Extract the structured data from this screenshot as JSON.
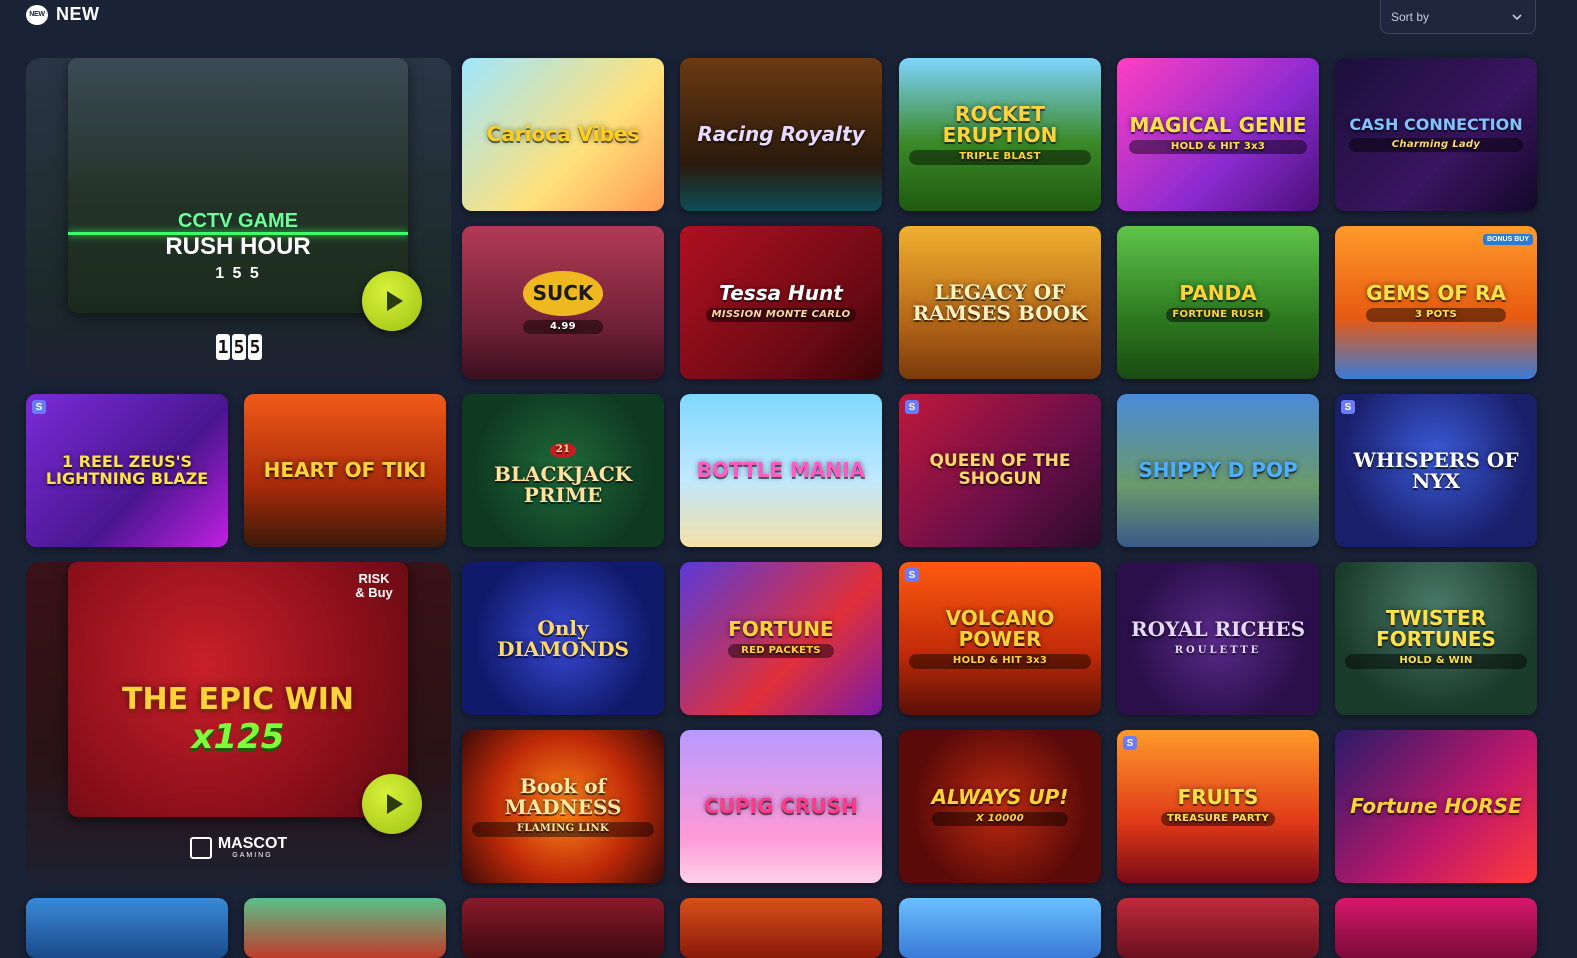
{
  "header": {
    "badge": "NEW",
    "title": "NEW"
  },
  "sort": {
    "label": "Sort by"
  },
  "featured": [
    {
      "line1": "CCTV GAME",
      "line2": "RUSH HOUR",
      "small_count": "1 5 5",
      "counter": [
        "1",
        "5",
        "5"
      ]
    },
    {
      "title": "THE EPIC WIN",
      "multiplier": "x125",
      "corner": "RISK & Buy",
      "provider": "MASCOT",
      "provider_sub": "GAMING"
    }
  ],
  "games": [
    {
      "title": "Carioca Vibes"
    },
    {
      "title": "Racing Royalty"
    },
    {
      "title": "ROCKET ERUPTION",
      "sub": "TRIPLE BLAST"
    },
    {
      "title": "MAGICAL GENIE",
      "sub": "HOLD & HIT 3x3"
    },
    {
      "title": "CASH CONNECTION",
      "sub": "Charming Lady"
    },
    {
      "title": "SUCK",
      "sub": "4.99"
    },
    {
      "title": "Tessa Hunt",
      "sub": "MISSION MONTE CARLO"
    },
    {
      "title": "LEGACY OF RAMSES BOOK"
    },
    {
      "title": "PANDA",
      "sub": "FORTUNE RUSH"
    },
    {
      "title": "GEMS OF RA",
      "sub": "3 POTS",
      "badge": "BONUS BUY"
    },
    {
      "title": "1 REEL ZEUS'S LIGHTNING BLAZE",
      "s": "S"
    },
    {
      "title": "HEART OF TIKI"
    },
    {
      "title": "BLACKJACK PRIME",
      "sub": "21"
    },
    {
      "title": "BOTTLE MANIA"
    },
    {
      "title": "QUEEN OF THE SHOGUN",
      "s": "S"
    },
    {
      "title": "SHIPPY D POP"
    },
    {
      "title": "WHISPERS OF NYX",
      "s": "S"
    },
    {
      "title": "Only DIAMONDS"
    },
    {
      "title": "FORTUNE",
      "sub": "RED PACKETS"
    },
    {
      "title": "VOLCANO POWER",
      "sub": "HOLD & HIT 3x3",
      "s": "S"
    },
    {
      "title": "ROYAL RICHES",
      "sub": "ROULETTE"
    },
    {
      "title": "TWISTER FORTUNES",
      "sub": "HOLD & WIN"
    },
    {
      "title": "Book of MADNESS",
      "sub": "FLAMING LINK"
    },
    {
      "title": "CUPIG CRUSH"
    },
    {
      "title": "ALWAYS UP!",
      "sub": "X 10000"
    },
    {
      "title": "FRUITS",
      "sub": "TREASURE PARTY",
      "s": "S"
    },
    {
      "title": "Fortune HORSE"
    }
  ],
  "colors": {
    "page_bg": "#1a2236",
    "play_button": "#b6d81f",
    "badge_s": "#6a7bff"
  }
}
